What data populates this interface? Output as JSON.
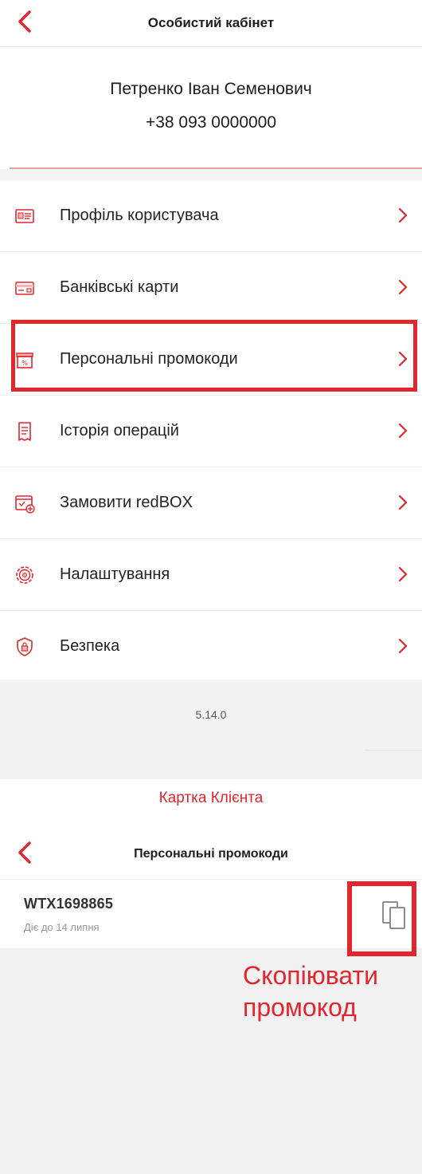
{
  "screen1": {
    "header": {
      "title": "Особистий кабінет"
    },
    "user": {
      "name": "Петренко Іван Семенович",
      "phone": "+38 093 0000000"
    },
    "menu": [
      {
        "label": "Профіль користувача",
        "icon": "profile-card-icon"
      },
      {
        "label": "Банківські карти",
        "icon": "bank-card-icon"
      },
      {
        "label": "Персональні промокоди",
        "icon": "promo-percent-icon"
      },
      {
        "label": "Історія операцій",
        "icon": "receipt-icon"
      },
      {
        "label": "Замовити redBOX",
        "icon": "redbox-icon"
      },
      {
        "label": "Налаштування",
        "icon": "gear-icon"
      },
      {
        "label": "Безпека",
        "icon": "shield-lock-icon"
      }
    ],
    "version": "5.14.0",
    "bottom_tab_label": "Картка Клієнта"
  },
  "screen2": {
    "header": {
      "title": "Персональні промокоди"
    },
    "promo": {
      "code": "WTX1698865",
      "valid_until": "Діє до 14 липня"
    },
    "annotation": "Скопіювати промокод"
  },
  "colors": {
    "accent": "#e3262d",
    "divider": "#ececec",
    "background_grey": "#f2f2f2"
  }
}
